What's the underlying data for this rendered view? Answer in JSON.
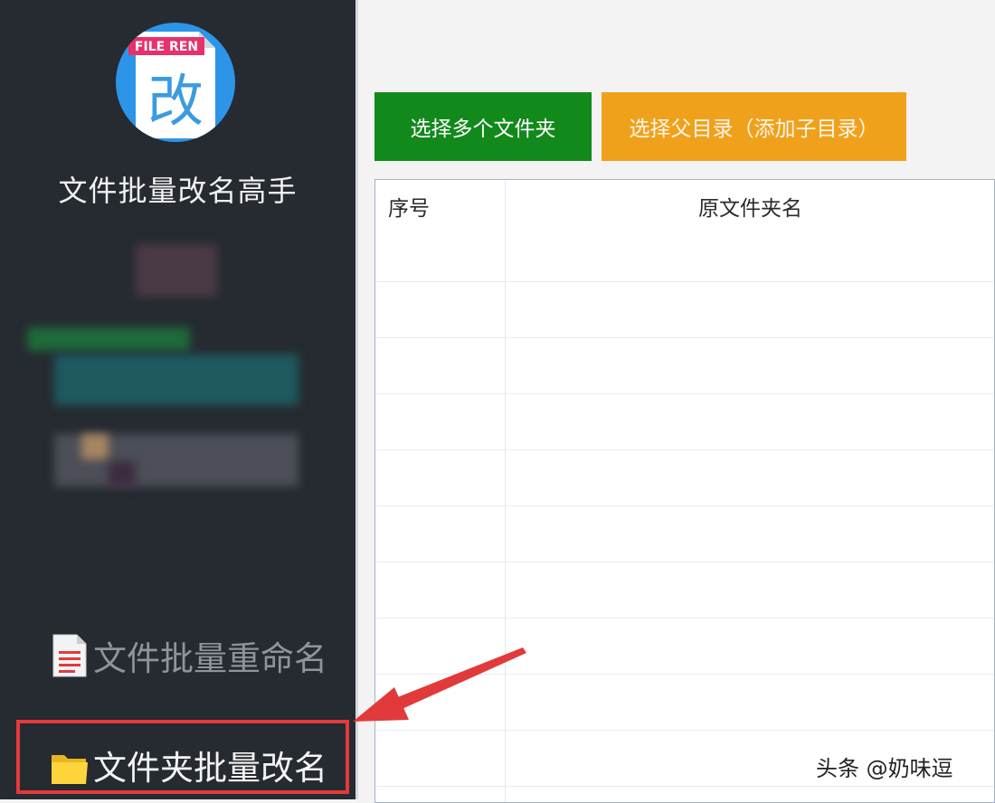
{
  "sidebar": {
    "app_title": "文件批量改名高手",
    "logo_banner": "FILE REN",
    "logo_glyph": "改",
    "nav": [
      {
        "label": "文件批量重命名",
        "icon": "document-list-icon",
        "active": false
      },
      {
        "label": "文件夹批量改名",
        "icon": "folder-icon",
        "active": true
      }
    ]
  },
  "toolbar": {
    "select_folders_label": "选择多个文件夹",
    "select_parent_label": "选择父目录（添加子目录）"
  },
  "table": {
    "columns": [
      "序号",
      "原文件夹名"
    ],
    "rows": []
  },
  "watermark": "头条 @奶味逗",
  "colors": {
    "sidebar_bg": "#262a31",
    "green_button": "#12891b",
    "orange_button": "#f0a11c",
    "highlight": "#e23a3a"
  }
}
